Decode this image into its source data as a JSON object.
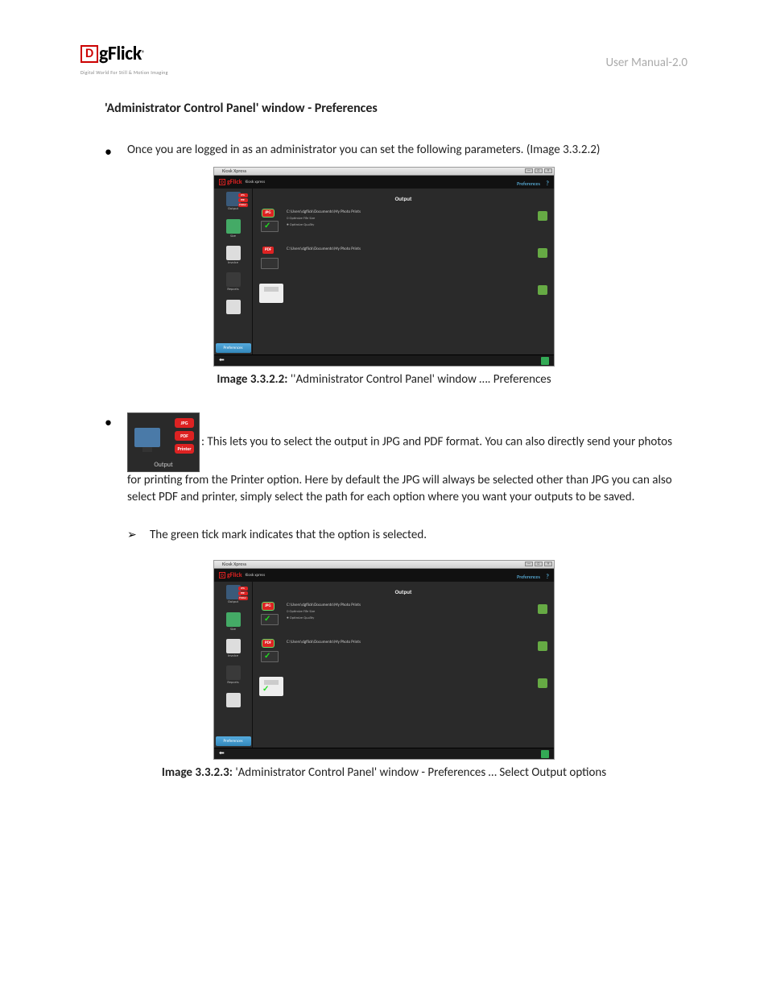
{
  "header": {
    "logo_letter": "D",
    "logo_text": "gFlick",
    "logo_reg": "®",
    "logo_tagline": "Digital World For Still & Motion Imaging",
    "right": "User Manual-2.0"
  },
  "title": "'Administrator Control Panel' window - Preferences",
  "bullet1": "Once you are logged in as an administrator you can set the following parameters. (Image 3.3.2.2)",
  "caption1_label": "Image 3.3.2.2:",
  "caption1_text": " ''Administrator Control Panel' window ….  Preferences",
  "bullet2_inline": ": This lets you to select the output in JPG and PDF format. You can also directly send your photos for printing from the Printer option. Here by default the JPG will always be selected other than JPG you can also select PDF and printer, simply select the path for each option where you want your outputs to be saved.",
  "arrow_text": "The green tick mark indicates that the option is selected.",
  "caption2_label": "Image 3.3.2.3:",
  "caption2_text": " 'Administrator Control Panel' window - Preferences … Select Output options",
  "screenshot": {
    "titlebar": "Kiosk Xpress",
    "brand_d": "D",
    "brand_text": "gFlick",
    "brand_sub": "Kiosk xpress",
    "pref_link": "Preferences",
    "help": "?",
    "main_title": "Output",
    "side": {
      "output": "Output",
      "size": "Size",
      "invoice": "Invoice",
      "reports": "Reports",
      "pref_btn": "Preferences"
    },
    "pill_jpg": "JPG",
    "pill_pdf": "PDF",
    "pill_printer": "Printer",
    "jpg_path": "C:\\Users\\dgflick\\Documents\\My Photo Prints",
    "jpg_opt1": "○ Optimize File Size",
    "jpg_opt2": "● Optimize Quality",
    "pdf_path": "C:\\Users\\dgflick\\Documents\\My Photo Prints",
    "back": "⬅"
  },
  "inline_thumb": {
    "jpg": "JPG",
    "pdf": "PDF",
    "printer": "Printer",
    "label": "Output"
  }
}
